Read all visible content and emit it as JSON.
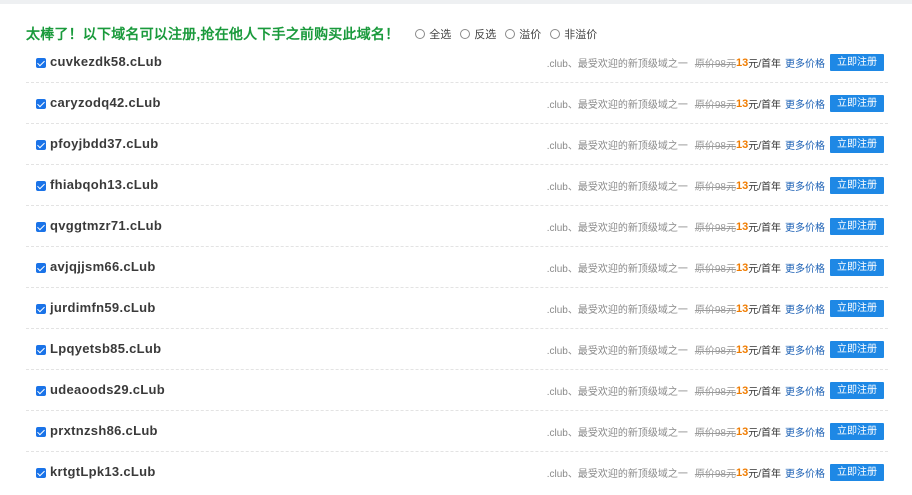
{
  "header": {
    "headline": "太棒了！以下域名可以注册,抢在他人下手之前购买此域名！",
    "options": [
      "全选",
      "反选",
      "溢价",
      "非溢价"
    ]
  },
  "row_template": {
    "desc": ".club、最受欢迎的新顶级域之一",
    "original_price": "原价98元",
    "price": "13",
    "unit": "元/首年",
    "more_prices": "更多价格",
    "register_button": "立即注册"
  },
  "domains": [
    "cuvkezdk58.cLub",
    "caryzodq42.cLub",
    "pfoyjbdd37.cLub",
    "fhiabqoh13.cLub",
    "qvggtmzr71.cLub",
    "avjqjjsm66.cLub",
    "jurdimfn59.cLub",
    "Lpqyetsb85.cLub",
    "udeaoods29.cLub",
    "prxtnzsh86.cLub",
    "krtgtLpk13.cLub"
  ],
  "colors": {
    "headline": "#1a9a3c",
    "checkbox": "#1a73e8",
    "price": "#f07c00",
    "button": "#1e88e5",
    "link": "#1a5fb4"
  }
}
